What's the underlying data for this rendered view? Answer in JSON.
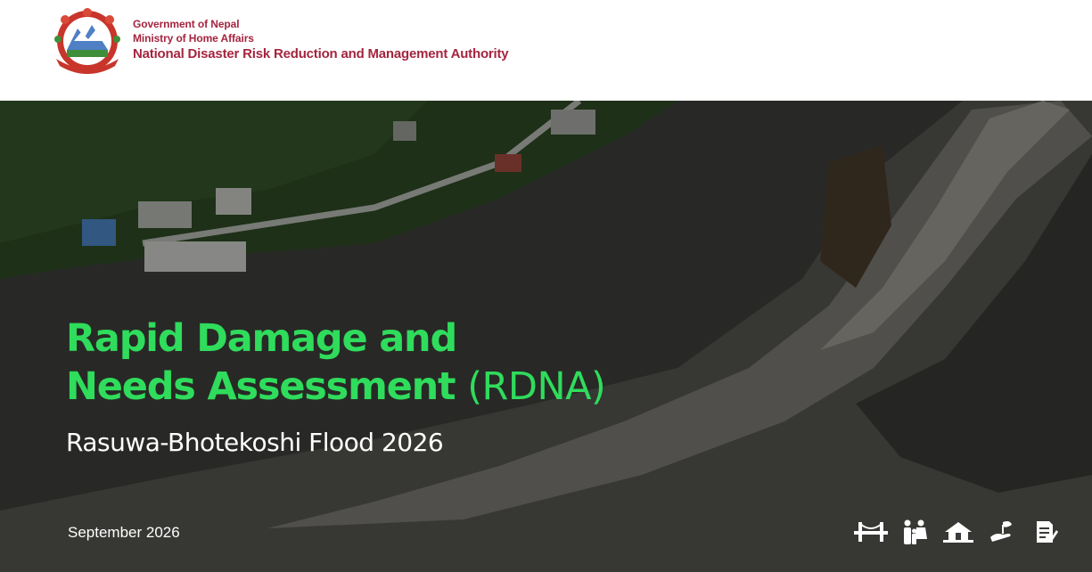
{
  "header": {
    "line1": "Government of Nepal",
    "line2": "Ministry of Home Affairs",
    "line3": "National Disaster Risk Reduction and Management Authority",
    "colors": {
      "org_text": "#a4253f"
    }
  },
  "hero": {
    "title_line1": "Rapid Damage and",
    "title_line2": "Needs Assessment",
    "title_abbr": "(RDNA)",
    "subtitle": "Rasuwa-Bhotekoshi Flood 2026",
    "date": "September 2026",
    "colors": {
      "title": "#2fdc5c",
      "text": "#ffffff"
    },
    "icons": [
      "bridge-icon",
      "family-icon",
      "house-icon",
      "hand-plant-icon",
      "document-icon"
    ]
  }
}
